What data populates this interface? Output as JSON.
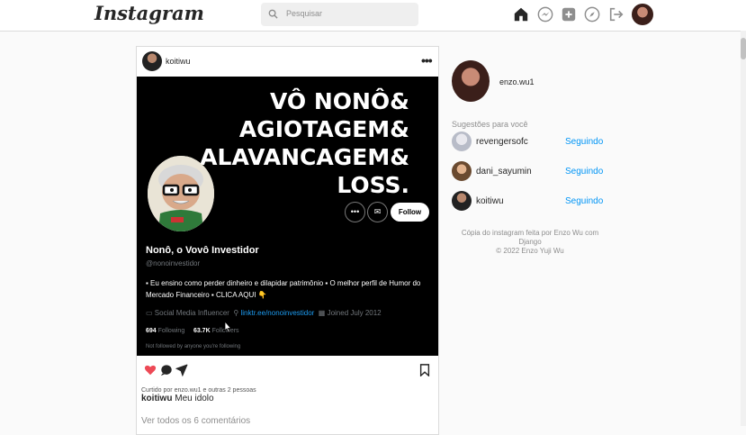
{
  "header": {
    "logo": "Instagram",
    "search_placeholder": "Pesquisar",
    "icons": [
      "home-icon",
      "messenger-icon",
      "new-post-icon",
      "explore-icon",
      "logout-icon",
      "profile-avatar"
    ]
  },
  "post": {
    "username": "koitiwu",
    "more_label": "•••",
    "image": {
      "headline": [
        "VÔ NONÔ&",
        "AGIOTAGEM&",
        "ALAVANCAGEM&",
        "LOSS."
      ],
      "profile_name": "Nonô, o Vovô Investidor",
      "profile_handle": "@nonoinvestidor",
      "bio": "▪ Eu ensino como perder dinheiro e dilapidar patrimônio ▪ O melhor perfil de Humor do Mercado Financeiro ▪ CLICA AQUI 👇",
      "category": "Social Media Influencer",
      "link": "linktr.ee/nonoinvestidor",
      "joined": "Joined July 2012",
      "following_count": "694",
      "following_label": "Following",
      "followers_count": "63.7K",
      "followers_label": "Followers",
      "not_followed": "Not followed by anyone you're following",
      "follow_button": "Follow",
      "more_button": "•••"
    },
    "liked_by": "Curtido por enzo.wu1 e outras 2 pessoas",
    "caption_user": "koitiwu",
    "caption_text": "Meu idolo",
    "view_comments": "Ver todos os 6 comentários",
    "liked": true
  },
  "sidebar": {
    "current_user": "enzo.wu1",
    "suggestions_title": "Sugestões para você",
    "suggestions": [
      {
        "username": "revengersofc",
        "action": "Seguindo"
      },
      {
        "username": "dani_sayumin",
        "action": "Seguindo"
      },
      {
        "username": "koitiwu",
        "action": "Seguindo"
      }
    ],
    "footer_line1": "Cópia do instagram feita por Enzo Wu com Django",
    "footer_line2": "© 2022 Enzo Yuji Wu"
  },
  "colors": {
    "accent": "#0095f6",
    "like": "#ed4956",
    "link_blue": "#1d9bf0"
  }
}
